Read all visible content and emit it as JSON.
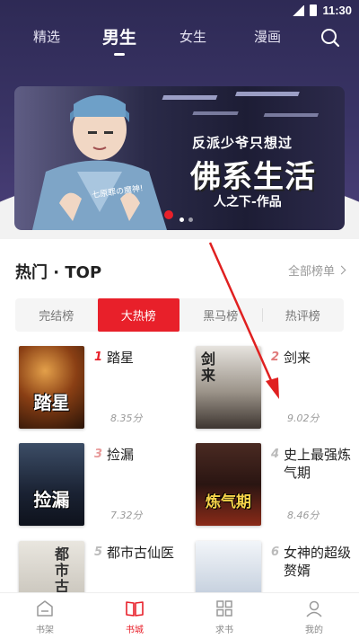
{
  "status": {
    "time": "11:30"
  },
  "nav": {
    "tabs": [
      "精选",
      "男生",
      "女生",
      "漫画"
    ],
    "active": 1
  },
  "banner": {
    "subtitle": "反派少爷只想过",
    "title": "佛系生活",
    "author": "人之下-作品",
    "note": "七原罪の魔神!"
  },
  "section": {
    "title": "热门 · TOP",
    "all_label": "全部榜单"
  },
  "rank_tabs": {
    "items": [
      "完结榜",
      "大热榜",
      "黑马榜",
      "热评榜"
    ],
    "active": 1
  },
  "books": [
    {
      "rank": "1",
      "name": "踏星",
      "score": "8.35分",
      "cover_title": "踏星",
      "cover_color": "#6b3a1a"
    },
    {
      "rank": "2",
      "name": "剑来",
      "score": "9.02分",
      "cover_title": "剑来",
      "cover_color": "#b9b4ae"
    },
    {
      "rank": "3",
      "name": "捡漏",
      "score": "7.32分",
      "cover_title": "捡漏",
      "cover_color": "#233044"
    },
    {
      "rank": "4",
      "name": "史上最强炼气期",
      "score": "8.46分",
      "cover_title": "炼气期",
      "cover_color": "#3a1f1a"
    },
    {
      "rank": "5",
      "name": "都市古仙医",
      "score": "",
      "cover_title": "都市古",
      "cover_color": "#d9d6cf"
    },
    {
      "rank": "6",
      "name": "女神的超级赘婿",
      "score": "",
      "cover_title": "",
      "cover_color": "#e7ecf3"
    }
  ],
  "bottom_nav": {
    "items": [
      "书架",
      "书城",
      "求书",
      "我的"
    ],
    "active": 1
  },
  "colors": {
    "accent": "#e8202a",
    "header": "#2e2a55"
  }
}
